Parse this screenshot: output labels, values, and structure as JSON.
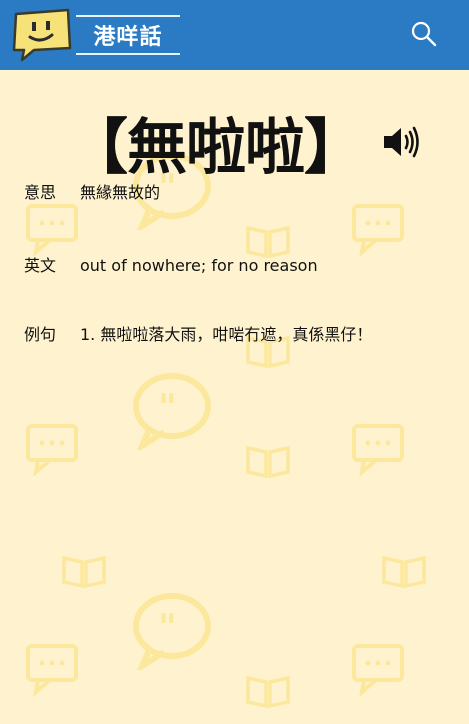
{
  "header": {
    "brand": "港咩話",
    "logo_icon": "chat-bubble-face-icon",
    "search_icon": "search-icon"
  },
  "entry": {
    "headword": "【無啦啦】",
    "audio_icon": "speaker-icon",
    "meaning_label": "意思",
    "meaning": "無緣無故的",
    "english_label": "英文",
    "english": "out of nowhere; for no reason",
    "example_label": "例句",
    "examples": [
      "1. 無啦啦落大雨，咁啱冇遮，真係黑仔！"
    ]
  },
  "colors": {
    "header_bg": "#2a7bc4",
    "page_bg": "#fff3cf",
    "pattern": "#fbe89c"
  }
}
